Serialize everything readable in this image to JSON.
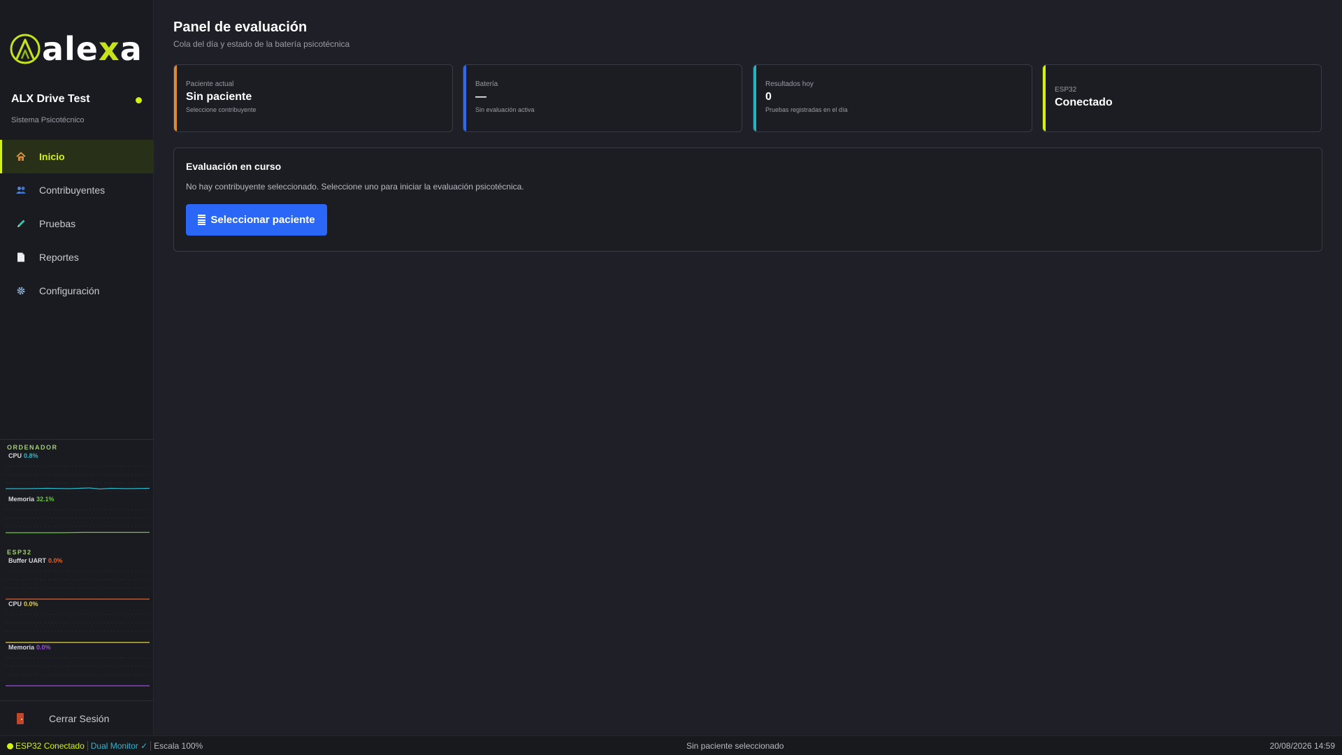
{
  "sidebar": {
    "logo": {
      "text_a": "ale",
      "text_x": "x",
      "text_b": "a"
    },
    "app_name": "ALX Drive Test",
    "app_subtitle": "Sistema Psicotécnico",
    "nav": [
      {
        "label": "Inicio",
        "icon": "house-icon"
      },
      {
        "label": "Contribuyentes",
        "icon": "people-icon"
      },
      {
        "label": "Pruebas",
        "icon": "pencil-icon"
      },
      {
        "label": "Reportes",
        "icon": "document-icon"
      },
      {
        "label": "Configuración",
        "icon": "gear-icon"
      }
    ],
    "monitor": {
      "ordenador_title": "ORDENADOR",
      "cpu_label": "CPU",
      "cpu_value": "0.8%",
      "mem_label": "Memoria",
      "mem_value": "32.1%",
      "esp32_title": "ESP32",
      "uart_label": "Buffer UART",
      "uart_value": "0.0%",
      "esp_cpu_label": "CPU",
      "esp_cpu_value": "0.0%",
      "esp_mem_label": "Memoria",
      "esp_mem_value": "0.0%",
      "colors": {
        "cpu": "#2bb8c8",
        "memory": "#6cc93c",
        "uart": "#e2622e",
        "esp_cpu": "#e8d23a",
        "esp_memory": "#9b4fe0"
      }
    },
    "logout_label": "Cerrar Sesión"
  },
  "main": {
    "title": "Panel de evaluación",
    "subtitle": "Cola del día y estado de la batería psicotécnica",
    "cards": [
      {
        "label": "Paciente actual",
        "value": "Sin paciente",
        "note": "Seleccione contribuyente",
        "accent": "#e08a2c"
      },
      {
        "label": "Batería",
        "value": "—",
        "note": "Sin evaluación activa",
        "accent": "#2d6cf0"
      },
      {
        "label": "Resultados hoy",
        "value": "0",
        "note": "Pruebas registradas en el día",
        "accent": "#25b3c4"
      },
      {
        "label": "ESP32",
        "value": "Conectado",
        "accent": "#d4f20f"
      }
    ],
    "evaluation": {
      "title": "Evaluación en curso",
      "text": "No hay contribuyente seleccionado. Seleccione uno para iniciar la evaluación psicotécnica.",
      "button_label": "Seleccionar paciente"
    }
  },
  "statusbar": {
    "esp": "ESP32 Conectado",
    "dual": "Dual Monitor ✓",
    "scale": "Escala 100%",
    "center": "Sin paciente seleccionado",
    "datetime": "20/08/2026 14:59"
  }
}
